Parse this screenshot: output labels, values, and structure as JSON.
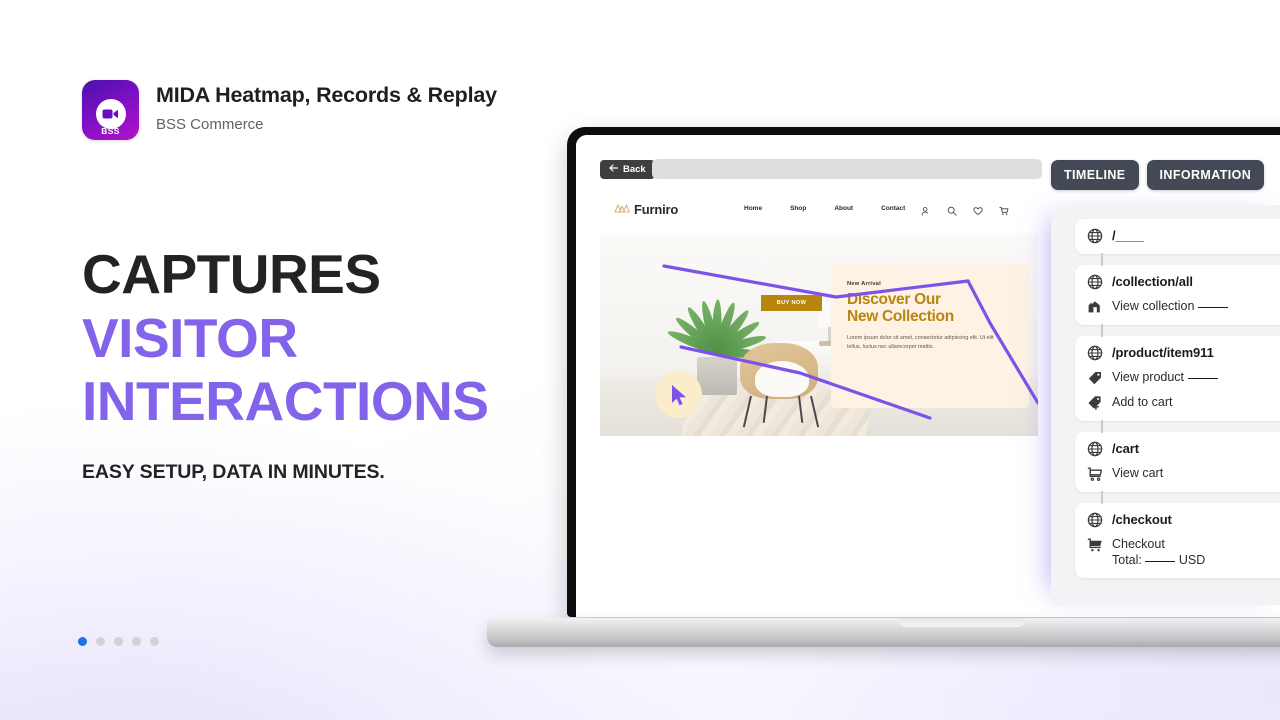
{
  "app": {
    "title": "MIDA Heatmap, Records & Replay",
    "vendor": "BSS Commerce",
    "logo_badge": "BSS",
    "logo_icon": "video-camera-icon",
    "logo_gradient_from": "#4b11a8",
    "logo_gradient_to": "#b412c8"
  },
  "headline": {
    "line1": "CAPTURES",
    "line2": "VISITOR",
    "line3": "INTERACTIONS",
    "subhead": "EASY SETUP, DATA IN MINUTES.",
    "dark_color": "#232323",
    "accent_color": "#8263ea"
  },
  "carousel": {
    "total": 5,
    "active_index": 0,
    "active_color": "#1a73e8",
    "inactive_color": "#d2d2d2"
  },
  "browser": {
    "back_label": "Back",
    "back_icon": "arrow-left-icon",
    "url_value": "",
    "url_placeholder": ""
  },
  "site": {
    "brand": "Furniro",
    "brand_icon": "mountain-logo-icon",
    "nav": [
      "Home",
      "Shop",
      "About",
      "Contact"
    ],
    "icons": [
      "user-icon",
      "search-icon",
      "heart-icon",
      "cart-icon"
    ],
    "hero": {
      "eyebrow": "New Arrival",
      "title_line1": "Discover Our",
      "title_line2": "New Collection",
      "body": "Lorem ipsum dolor sit amet, consectetur adipiscing elit. Ut elit tellus, luctus nec ullamcorper mattis.",
      "cta": "BUY NOW",
      "gold_color": "#b8860f",
      "card_bg": "#fdf2e3"
    },
    "tracking": {
      "path_color": "#7d52e8",
      "cursor_icon": "mouse-cursor-icon"
    }
  },
  "timeline": {
    "tabs": [
      {
        "label": "TIMELINE",
        "active": true
      },
      {
        "label": "INFORMATION",
        "active": false
      }
    ],
    "tab_bg": "#434a56",
    "panel_bg": "#f3f2f5",
    "groups": [
      {
        "url": "/____",
        "url_icon": "globe-icon",
        "events": []
      },
      {
        "url": "/collection/all",
        "url_icon": "globe-icon",
        "events": [
          {
            "label": "View collection ____",
            "icon": "storefront-icon"
          }
        ]
      },
      {
        "url": "/product/item911",
        "url_icon": "globe-icon",
        "events": [
          {
            "label": "View product ____",
            "icon": "tag-icon"
          },
          {
            "label": "Add to cart",
            "icon": "tag-plus-icon"
          }
        ]
      },
      {
        "url": "/cart",
        "url_icon": "globe-icon",
        "events": [
          {
            "label": "View cart",
            "icon": "cart-outline-icon"
          }
        ]
      },
      {
        "url": "/checkout",
        "url_icon": "globe-icon",
        "events": [
          {
            "label": "Checkout",
            "label2": "Total: ____ USD",
            "icon": "cart-filled-icon"
          }
        ]
      }
    ]
  }
}
